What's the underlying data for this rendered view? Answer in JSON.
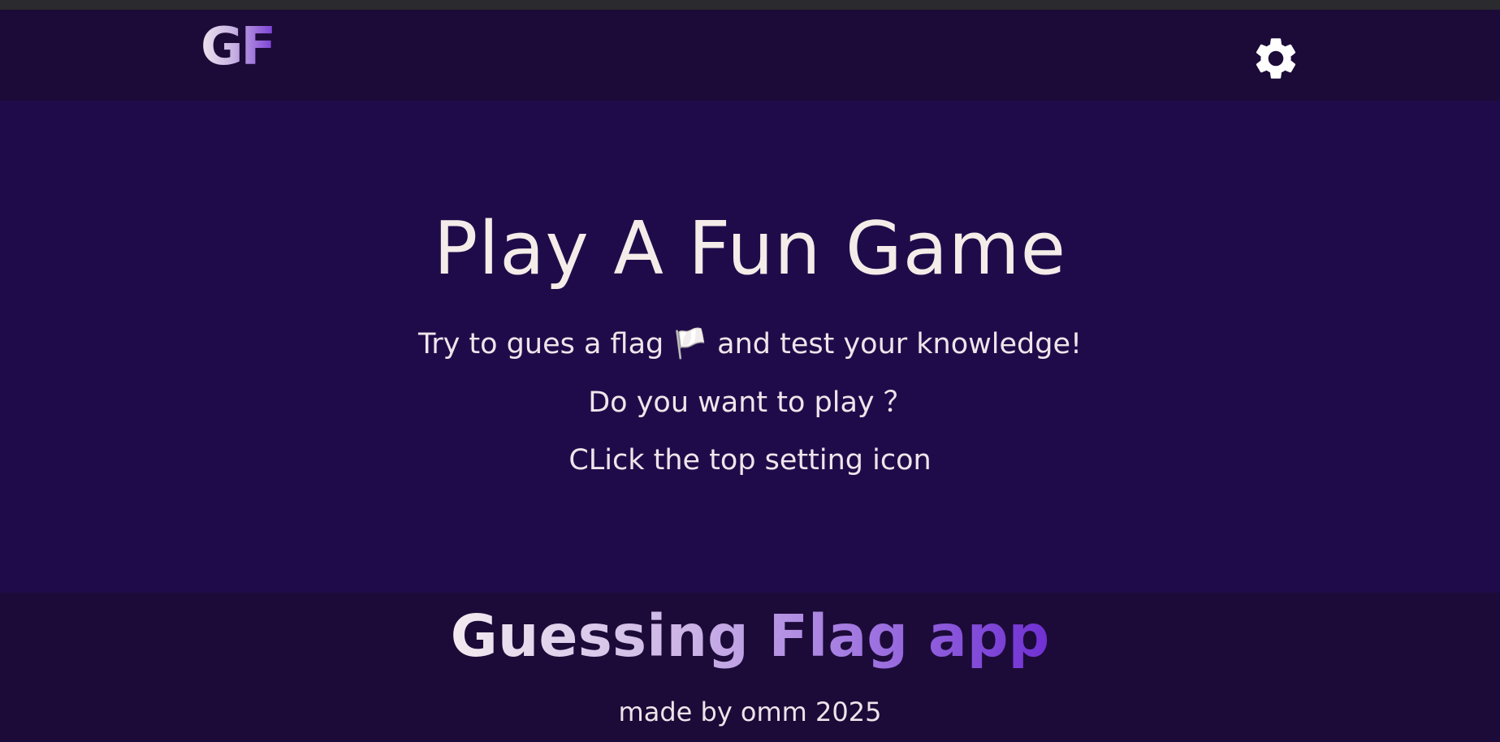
{
  "nav": {
    "logo": "GF",
    "settings_icon": "gear-icon"
  },
  "hero": {
    "title": "Play A Fun Game",
    "line1_before": "Try to gues a flag",
    "flag_glyph": "🏳️",
    "line1_after": "and test your knowledge!",
    "line2": "Do you want to play ？",
    "line3": "CLick the top setting icon"
  },
  "footer": {
    "title": "Guessing Flag app",
    "credit": "made by omm 2025"
  },
  "colors": {
    "nav_bg": "#1c0b38",
    "hero_bg": "#200b4a",
    "text": "#f4ece8",
    "accent": "#7b3fd6"
  }
}
